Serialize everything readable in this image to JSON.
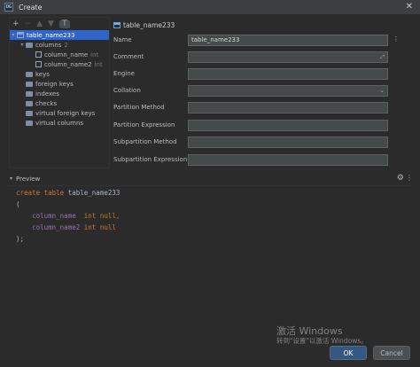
{
  "window": {
    "title": "Create",
    "icon": "datagrip-app-icon"
  },
  "toolbar": {
    "add": "+",
    "remove": "−",
    "up": "▲",
    "down": "▼",
    "filter": "⊤"
  },
  "tree": {
    "root": "table_name233",
    "columns_label": "columns",
    "columns_count": "2",
    "columns": [
      {
        "name": "column_name",
        "type": "int"
      },
      {
        "name": "column_name2",
        "type": "int"
      }
    ],
    "folders": [
      "keys",
      "foreign keys",
      "indexes",
      "checks",
      "virtual foreign keys",
      "virtual columns"
    ]
  },
  "tab": {
    "label": "table_name233"
  },
  "form": {
    "name_label": "Name",
    "name_value": "table_name233",
    "comment_label": "Comment",
    "engine_label": "Engine",
    "collation_label": "Collation",
    "partition_method_label": "Partition Method",
    "partition_expression_label": "Partition Expression",
    "subpartition_method_label": "Subpartition Method",
    "subpartition_expression_label": "Subpartition Expression"
  },
  "preview": {
    "title": "Preview",
    "code": {
      "l1_kw": "create table",
      "l1_id": " table_name233",
      "l2": "(",
      "l3_indent": "    ",
      "l3_id": "column_name  ",
      "l3_kw": "int null",
      "l3_tail": ",",
      "l4_indent": "    ",
      "l4_id": "column_name2 ",
      "l4_kw": "int null",
      "l5": ");"
    }
  },
  "buttons": {
    "ok": "OK",
    "cancel": "Cancel"
  },
  "watermark": {
    "line1": "激活 Windows",
    "line2": "转到\"设置\"以激活 Windows。"
  }
}
